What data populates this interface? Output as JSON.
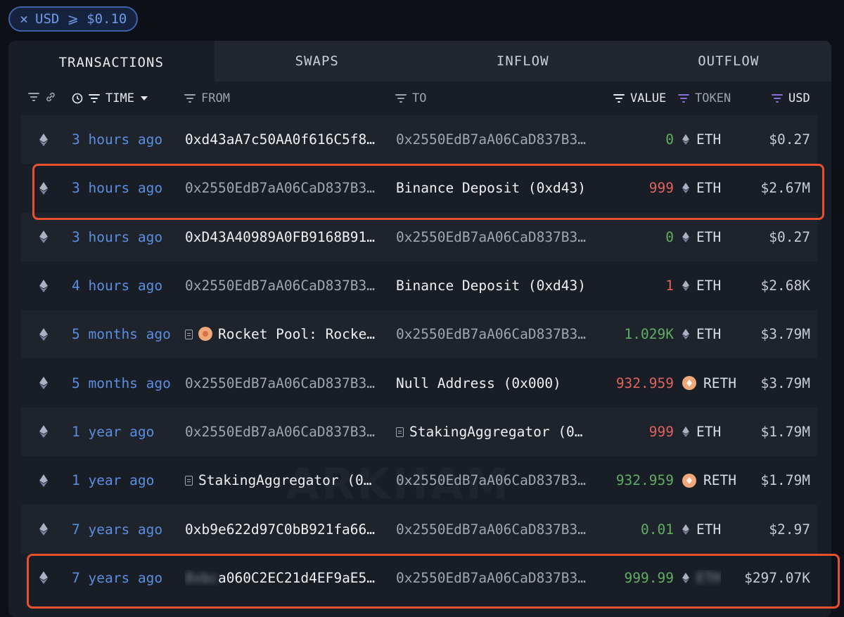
{
  "filter_chip": {
    "label": "USD ⩾ $0.10"
  },
  "tabs": [
    {
      "label": "TRANSACTIONS",
      "active": true
    },
    {
      "label": "SWAPS"
    },
    {
      "label": "INFLOW"
    },
    {
      "label": "OUTFLOW"
    }
  ],
  "columns": {
    "time": "TIME",
    "from": "FROM",
    "to": "TO",
    "value": "VALUE",
    "token": "TOKEN",
    "usd": "USD"
  },
  "watermark": "ARKHAM",
  "colors": {
    "accent_blue": "#5a8ee0",
    "negative": "#e0625e",
    "positive": "#5fae63",
    "highlight": "#e8512f"
  },
  "rows": [
    {
      "time": "3 hours ago",
      "from": "0xd43aA7c50AA0f616C5f8…",
      "to": "0x2550EdB7aA06CaD837B3…",
      "value": "0",
      "token": "ETH",
      "usd": "$0.27"
    },
    {
      "time": "3 hours ago",
      "from": "0x2550EdB7aA06CaD837B3…",
      "to": "Binance Deposit (0xd43)",
      "value": "999",
      "token": "ETH",
      "usd": "$2.67M"
    },
    {
      "time": "3 hours ago",
      "from": "0xD43A40989A0FB9168B91…",
      "to": "0x2550EdB7aA06CaD837B3…",
      "value": "0",
      "token": "ETH",
      "usd": "$0.27"
    },
    {
      "time": "4 hours ago",
      "from": "0x2550EdB7aA06CaD837B3…",
      "to": "Binance Deposit (0xd43)",
      "value": "1",
      "token": "ETH",
      "usd": "$2.68K"
    },
    {
      "time": "5 months ago",
      "from": "Rocket Pool: Rocke…",
      "to": "0x2550EdB7aA06CaD837B3…",
      "value": "1.029K",
      "token": "ETH",
      "usd": "$3.79M"
    },
    {
      "time": "5 months ago",
      "from": "0x2550EdB7aA06CaD837B3…",
      "to": "Null Address (0x000)",
      "value": "932.959",
      "token": "RETH",
      "usd": "$3.79M"
    },
    {
      "time": "1 year ago",
      "from": "0x2550EdB7aA06CaD837B3…",
      "to": "StakingAggregator (0…",
      "value": "999",
      "token": "ETH",
      "usd": "$1.79M"
    },
    {
      "time": "1 year ago",
      "from": "StakingAggregator (0…",
      "to": "0x2550EdB7aA06CaD837B3…",
      "value": "932.959",
      "token": "RETH",
      "usd": "$1.79M"
    },
    {
      "time": "7 years ago",
      "from": "0xb9e622d97C0bB921fa66…",
      "to": "0x2550EdB7aA06CaD837B3…",
      "value": "0.01",
      "token": "ETH",
      "usd": "$2.97"
    },
    {
      "time": "7 years ago",
      "from": "a060C2EC21d4EF9aE51…",
      "to": "0x2550EdB7aA06CaD837B3…",
      "value": "999.99",
      "token": "",
      "usd": "$297.07K"
    }
  ]
}
